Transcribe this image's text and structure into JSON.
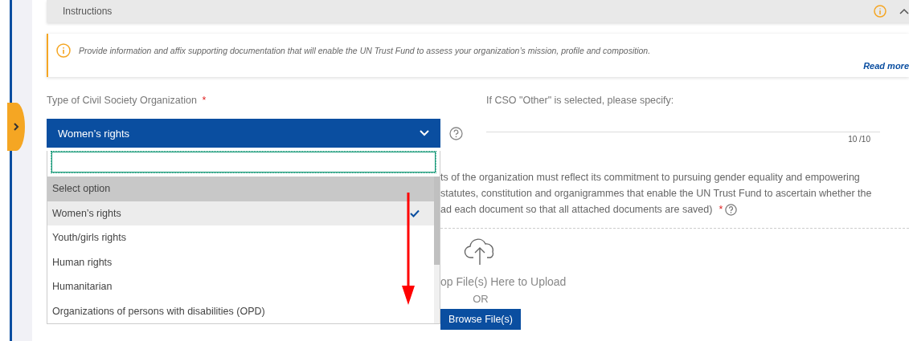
{
  "instructions": {
    "title": "Instructions",
    "expanded": true
  },
  "info_banner": {
    "text": "Provide information and affix supporting documentation that will enable the UN Trust Fund to assess your organization’s mission, profile and composition.",
    "link": "Read more"
  },
  "cso_type": {
    "label": "Type of Civil Society Organization",
    "required": "*",
    "value": "Women’s rights",
    "expanded": true,
    "options": [
      {
        "label": "Select option",
        "highlighted": true,
        "selected": false
      },
      {
        "label": "Women’s rights",
        "highlighted": false,
        "selected": true
      },
      {
        "label": "Youth/girls rights",
        "highlighted": false,
        "selected": false
      },
      {
        "label": "Human rights",
        "highlighted": false,
        "selected": false
      },
      {
        "label": "Humanitarian",
        "highlighted": false,
        "selected": false
      },
      {
        "label": "Organizations of persons with disabilities (OPD)",
        "highlighted": false,
        "selected": false
      }
    ]
  },
  "other_field": {
    "label": "If CSO \"Other\" is selected, please specify:",
    "counter": "10 /10"
  },
  "documents": {
    "lines": [
      "ts of the organization must reflect its commitment to pursuing gender equality and empowering",
      "statutes, constitution and organigrammes that enable the UN Trust Fund to ascertain whether the",
      "ad each document so that all attached documents are saved)"
    ],
    "required": "*",
    "drop_text": "op File(s) Here to Upload",
    "or": "OR",
    "browse": "Browse File(s)"
  }
}
